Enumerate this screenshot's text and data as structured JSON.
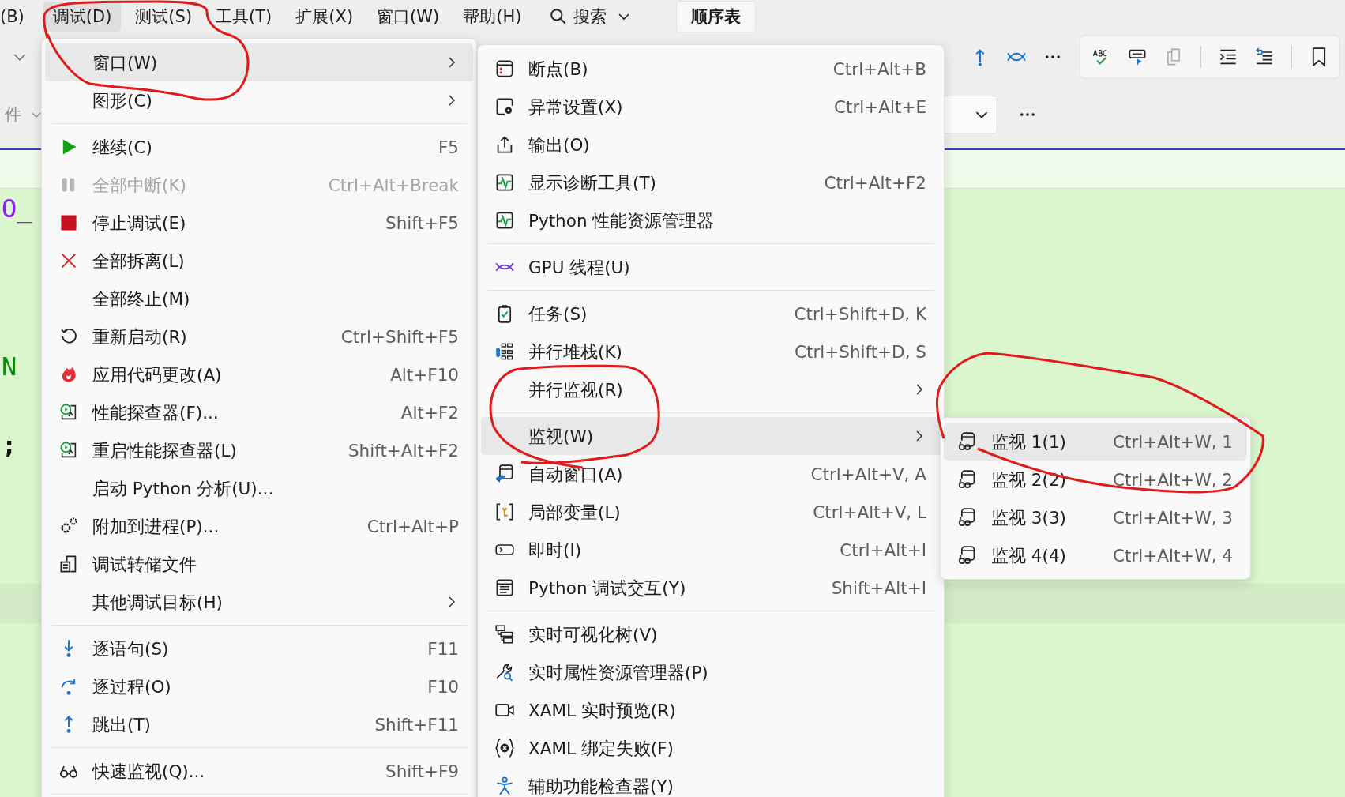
{
  "menu_bar": {
    "items": [
      {
        "label": "(B)",
        "selected": false
      },
      {
        "label": "调试(D)",
        "selected": true
      },
      {
        "label": "测试(S)",
        "selected": false
      },
      {
        "label": "工具(T)",
        "selected": false
      },
      {
        "label": "扩展(X)",
        "selected": false
      },
      {
        "label": "窗口(W)",
        "selected": false
      },
      {
        "label": "帮助(H)",
        "selected": false
      }
    ],
    "search": {
      "label": "搜索"
    },
    "document_tab": {
      "label": "顺序表"
    }
  },
  "toolbar": {
    "partial_label": "件"
  },
  "code_fragments": [
    {
      "text": "O_",
      "kind": "keyword"
    },
    {
      "text": "N",
      "kind": "constant"
    },
    {
      "text": ";",
      "kind": "punctuation"
    }
  ],
  "debug_menu": {
    "items": [
      {
        "kind": "item",
        "label": "窗口(W)",
        "submenu": true,
        "disabled": false,
        "selected": true
      },
      {
        "kind": "item",
        "label": "图形(C)",
        "submenu": true,
        "disabled": false,
        "selected": false
      },
      {
        "kind": "separator"
      },
      {
        "kind": "item",
        "label": "继续(C)",
        "shortcut": "F5",
        "submenu": false,
        "disabled": false,
        "selected": false
      },
      {
        "kind": "item",
        "label": "全部中断(K)",
        "shortcut": "Ctrl+Alt+Break",
        "submenu": false,
        "disabled": true,
        "selected": false
      },
      {
        "kind": "item",
        "label": "停止调试(E)",
        "shortcut": "Shift+F5",
        "submenu": false,
        "disabled": false,
        "selected": false
      },
      {
        "kind": "item",
        "label": "全部拆离(L)",
        "submenu": false,
        "disabled": false,
        "selected": false
      },
      {
        "kind": "item",
        "label": "全部终止(M)",
        "submenu": false,
        "disabled": false,
        "selected": false
      },
      {
        "kind": "item",
        "label": "重新启动(R)",
        "shortcut": "Ctrl+Shift+F5",
        "submenu": false,
        "disabled": false,
        "selected": false
      },
      {
        "kind": "item",
        "label": "应用代码更改(A)",
        "shortcut": "Alt+F10",
        "submenu": false,
        "disabled": false,
        "selected": false
      },
      {
        "kind": "item",
        "label": "性能探查器(F)...",
        "shortcut": "Alt+F2",
        "submenu": false,
        "disabled": false,
        "selected": false
      },
      {
        "kind": "item",
        "label": "重启性能探查器(L)",
        "shortcut": "Shift+Alt+F2",
        "submenu": false,
        "disabled": false,
        "selected": false
      },
      {
        "kind": "item",
        "label": "启动 Python 分析(U)...",
        "submenu": false,
        "disabled": false,
        "selected": false
      },
      {
        "kind": "item",
        "label": "附加到进程(P)...",
        "shortcut": "Ctrl+Alt+P",
        "submenu": false,
        "disabled": false,
        "selected": false
      },
      {
        "kind": "item",
        "label": "调试转储文件",
        "submenu": false,
        "disabled": false,
        "selected": false
      },
      {
        "kind": "item",
        "label": "其他调试目标(H)",
        "submenu": true,
        "disabled": false,
        "selected": false
      },
      {
        "kind": "separator"
      },
      {
        "kind": "item",
        "label": "逐语句(S)",
        "shortcut": "F11",
        "submenu": false,
        "disabled": false,
        "selected": false
      },
      {
        "kind": "item",
        "label": "逐过程(O)",
        "shortcut": "F10",
        "submenu": false,
        "disabled": false,
        "selected": false
      },
      {
        "kind": "item",
        "label": "跳出(T)",
        "shortcut": "Shift+F11",
        "submenu": false,
        "disabled": false,
        "selected": false
      },
      {
        "kind": "separator"
      },
      {
        "kind": "item",
        "label": "快速监视(Q)...",
        "shortcut": "Shift+F9",
        "submenu": false,
        "disabled": false,
        "selected": false
      },
      {
        "kind": "separator"
      }
    ]
  },
  "window_submenu": {
    "items": [
      {
        "kind": "item",
        "label": "断点(B)",
        "shortcut": "Ctrl+Alt+B",
        "submenu": false,
        "disabled": false,
        "selected": false
      },
      {
        "kind": "item",
        "label": "异常设置(X)",
        "shortcut": "Ctrl+Alt+E",
        "submenu": false,
        "disabled": false,
        "selected": false
      },
      {
        "kind": "item",
        "label": "输出(O)",
        "submenu": false,
        "disabled": false,
        "selected": false
      },
      {
        "kind": "item",
        "label": "显示诊断工具(T)",
        "shortcut": "Ctrl+Alt+F2",
        "submenu": false,
        "disabled": false,
        "selected": false
      },
      {
        "kind": "item",
        "label": "Python 性能资源管理器",
        "submenu": false,
        "disabled": false,
        "selected": false
      },
      {
        "kind": "separator"
      },
      {
        "kind": "item",
        "label": "GPU 线程(U)",
        "submenu": false,
        "disabled": false,
        "selected": false
      },
      {
        "kind": "separator"
      },
      {
        "kind": "item",
        "label": "任务(S)",
        "shortcut": "Ctrl+Shift+D, K",
        "submenu": false,
        "disabled": false,
        "selected": false
      },
      {
        "kind": "item",
        "label": "并行堆栈(K)",
        "shortcut": "Ctrl+Shift+D, S",
        "submenu": false,
        "disabled": false,
        "selected": false
      },
      {
        "kind": "item",
        "label": "并行监视(R)",
        "submenu": true,
        "disabled": false,
        "selected": false
      },
      {
        "kind": "separator"
      },
      {
        "kind": "item",
        "label": "监视(W)",
        "submenu": true,
        "disabled": false,
        "selected": true
      },
      {
        "kind": "item",
        "label": "自动窗口(A)",
        "shortcut": "Ctrl+Alt+V, A",
        "submenu": false,
        "disabled": false,
        "selected": false
      },
      {
        "kind": "item",
        "label": "局部变量(L)",
        "shortcut": "Ctrl+Alt+V, L",
        "submenu": false,
        "disabled": false,
        "selected": false
      },
      {
        "kind": "item",
        "label": "即时(I)",
        "shortcut": "Ctrl+Alt+I",
        "submenu": false,
        "disabled": false,
        "selected": false
      },
      {
        "kind": "item",
        "label": "Python 调试交互(Y)",
        "shortcut": "Shift+Alt+I",
        "submenu": false,
        "disabled": false,
        "selected": false
      },
      {
        "kind": "separator"
      },
      {
        "kind": "item",
        "label": "实时可视化树(V)",
        "submenu": false,
        "disabled": false,
        "selected": false
      },
      {
        "kind": "item",
        "label": "实时属性资源管理器(P)",
        "submenu": false,
        "disabled": false,
        "selected": false
      },
      {
        "kind": "item",
        "label": "XAML 实时预览(R)",
        "submenu": false,
        "disabled": false,
        "selected": false
      },
      {
        "kind": "item",
        "label": "XAML 绑定失败(F)",
        "submenu": false,
        "disabled": false,
        "selected": false
      },
      {
        "kind": "item",
        "label": "辅助功能检查器(Y)",
        "submenu": false,
        "disabled": false,
        "selected": false
      }
    ]
  },
  "watch_submenu": {
    "items": [
      {
        "kind": "item",
        "label": "监视 1(1)",
        "shortcut": "Ctrl+Alt+W, 1",
        "submenu": false,
        "disabled": false,
        "selected": true
      },
      {
        "kind": "item",
        "label": "监视 2(2)",
        "shortcut": "Ctrl+Alt+W, 2",
        "submenu": false,
        "disabled": false,
        "selected": false
      },
      {
        "kind": "item",
        "label": "监视 3(3)",
        "shortcut": "Ctrl+Alt+W, 3",
        "submenu": false,
        "disabled": false,
        "selected": false
      },
      {
        "kind": "item",
        "label": "监视 4(4)",
        "shortcut": "Ctrl+Alt+W, 4",
        "submenu": false,
        "disabled": false,
        "selected": false
      }
    ]
  }
}
